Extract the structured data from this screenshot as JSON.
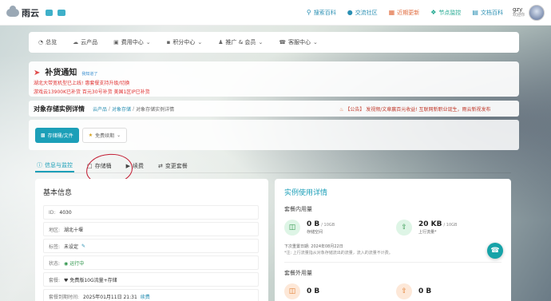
{
  "brand": {
    "name": "雨云"
  },
  "topnav": [
    {
      "label": "搜索百科",
      "icon": "search-icon"
    },
    {
      "label": "交流社区",
      "icon": "chat-icon"
    },
    {
      "label": "近期更新",
      "icon": "calendar-icon"
    },
    {
      "label": "节点监控",
      "icon": "pin-icon"
    },
    {
      "label": "文档百科",
      "icon": "book-icon"
    }
  ],
  "user": {
    "name": "gzy",
    "subtitle": "欢迎你"
  },
  "mainnav": [
    {
      "label": "总览",
      "icon": "dashboard-icon"
    },
    {
      "label": "云产品",
      "icon": "cloud-icon"
    },
    {
      "label": "费用中心",
      "icon": "card-icon",
      "dropdown": true
    },
    {
      "label": "积分中心",
      "icon": "gift-icon",
      "dropdown": true
    },
    {
      "label": "推广 & 会员",
      "icon": "users-icon",
      "dropdown": true
    },
    {
      "label": "客服中心",
      "icon": "headset-icon",
      "dropdown": true
    }
  ],
  "notice": {
    "title": "补货通知",
    "known_label": "我知道了",
    "lines": [
      "湖北大带宽机型已上线! 惠套餐支持升级/切换",
      "游戏云13900K已补货 百元30号补货 美国1区IP已补货"
    ]
  },
  "breadcrumb": {
    "title": "对象存储实例详情",
    "items": [
      "云产品",
      "对象存储",
      "对象存储实例详情"
    ],
    "announcement": "【公告】 发视频/文章赢百元收益! 互联网新职业诞生，雨云新视发布"
  },
  "actions": {
    "primary": "存储桶/文件",
    "secondary": "免费续期"
  },
  "tabs": [
    {
      "label": "信息与监控",
      "active": true
    },
    {
      "label": "存储桶",
      "active": false
    },
    {
      "label": "续费",
      "active": false
    },
    {
      "label": "变更套餐",
      "active": false
    }
  ],
  "basic_info": {
    "title": "基本信息",
    "rows": [
      {
        "label": "ID:",
        "value": "4030"
      },
      {
        "label": "地区:",
        "value": "湖北十堰"
      },
      {
        "label": "标签:",
        "value": "未设定"
      },
      {
        "label": "状态:",
        "value": "运行中"
      },
      {
        "label": "套餐:",
        "value": "免费版10G流量+存储"
      },
      {
        "label": "套餐到期时间:",
        "value": "2025年01月11日 21:31",
        "link": "续费"
      }
    ]
  },
  "usage": {
    "title": "实例使用详情",
    "plan_section": "套餐内用量",
    "storage": {
      "value": "0 B",
      "unit": "/ 10GB",
      "label": "存储空间"
    },
    "traffic": {
      "value": "20 KB",
      "unit": "/ 10GB",
      "label": "上行流量*"
    },
    "reset_date": "下次重置日期: 2024年08月22日",
    "note": "*注: 上行流量指从对象存储流出的流量，流入的流量不计费。",
    "extra_section": "套餐外用量",
    "extra_storage": "0 B",
    "extra_traffic": "0 B"
  },
  "colors": {
    "accent": "#1c9fb8",
    "danger": "#e03131",
    "success": "#2b9348"
  }
}
